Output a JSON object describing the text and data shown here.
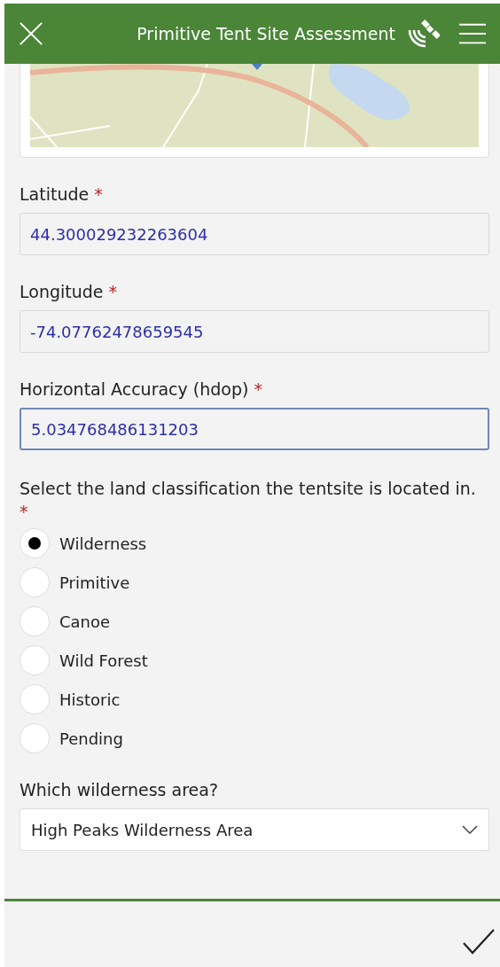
{
  "header": {
    "title": "Primitive Tent Site Assessment"
  },
  "fields": [
    {
      "label": "Latitude",
      "required_mark": "*",
      "value": "44.300029232263604",
      "focused": false
    },
    {
      "label": "Longitude",
      "required_mark": "*",
      "value": "-74.07762478659545",
      "focused": false
    },
    {
      "label": "Horizontal Accuracy (hdop)",
      "required_mark": "*",
      "value": "5.034768486131203",
      "focused": true
    }
  ],
  "question": {
    "label": "Select the land classification the tentsite is located in.",
    "required_mark": "*",
    "options": [
      {
        "label": "Wilderness",
        "selected": true
      },
      {
        "label": "Primitive",
        "selected": false
      },
      {
        "label": "Canoe",
        "selected": false
      },
      {
        "label": "Wild Forest",
        "selected": false
      },
      {
        "label": "Historic",
        "selected": false
      },
      {
        "label": "Pending",
        "selected": false
      }
    ]
  },
  "dropdown": {
    "label": "Which wilderness area?",
    "value": "High Peaks Wilderness Area"
  }
}
